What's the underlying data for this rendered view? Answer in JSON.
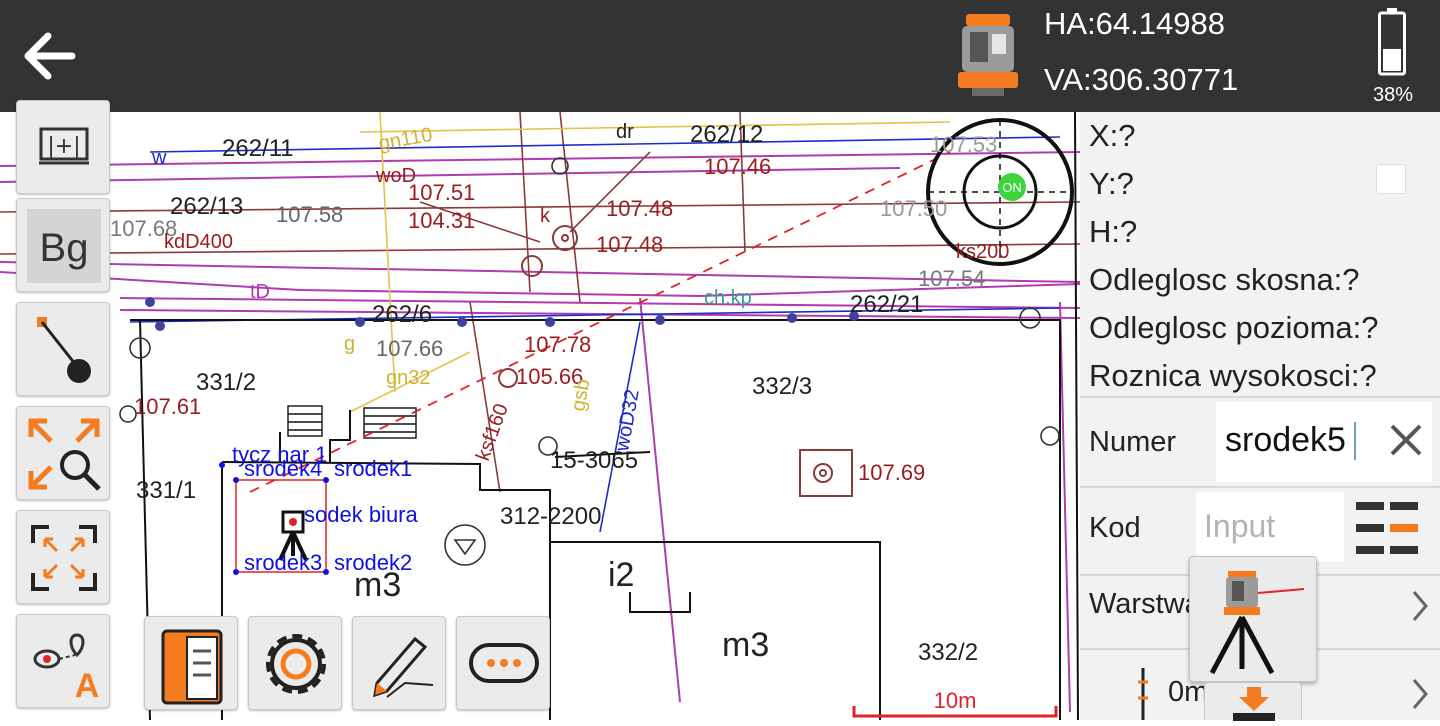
{
  "toolbar": {
    "ha_label": "HA:64.14988",
    "va_label": "VA:306.30771",
    "battery_percent": "38%",
    "battery_level": 0.38
  },
  "map": {
    "compass_label": "ON",
    "scale_label": "10m",
    "parcels": [
      "262/11",
      "262/12",
      "262/13",
      "262/21",
      "331/2",
      "331/1",
      "332/3",
      "332/2",
      "312-2200",
      "15-3065",
      "262/6"
    ],
    "heights": [
      "107.51",
      "104.31",
      "107.48",
      "107.48",
      "107.46",
      "107.58",
      "107.66",
      "107.78",
      "105.66",
      "107.69",
      "107.61",
      "107.54",
      "107.68",
      "107.53",
      "107.50"
    ],
    "labels": [
      "kdD400",
      "woD",
      "gn110",
      "gn32",
      "ch.kp",
      "ksf160",
      "gsb",
      "woD32",
      "dr",
      "ks200",
      "tD",
      "k",
      "w",
      "g"
    ],
    "buildings": [
      "m3",
      "m3",
      "i2"
    ],
    "points": [
      "tycz nar 1",
      "srodek4",
      "srodek1",
      "sodek biura",
      "srodek3",
      "srodek2"
    ]
  },
  "tools": {
    "survey": "measure-mode-icon",
    "background": "Bg",
    "line": "draw-line-icon",
    "zoom": "zoom-extents-icon",
    "fit": "fit-screen-icon",
    "stakeout": "stakeout-point-icon",
    "layers": "layers-book-icon",
    "settings": "gear-icon",
    "edit": "pencil-icon",
    "more": "more-icon"
  },
  "panel": {
    "x": "X:?",
    "y": "Y:?",
    "h": "H:?",
    "slope": "Odleglosc skosna:?",
    "horizontal": "Odleglosc pozioma:?",
    "height_diff": "Roznica wysokosci:?",
    "numer_label": "Numer",
    "numer_value": "srodek5",
    "kod_label": "Kod",
    "kod_placeholder": "Input",
    "warstwa_label": "Warstwa",
    "dist_value": "0m"
  },
  "colors": {
    "toolbar_bg": "#333333",
    "accent_orange": "#f47b20",
    "point_blue": "#1010e0",
    "height_red": "#9b1c1c",
    "compass_green": "#3ed43e"
  }
}
